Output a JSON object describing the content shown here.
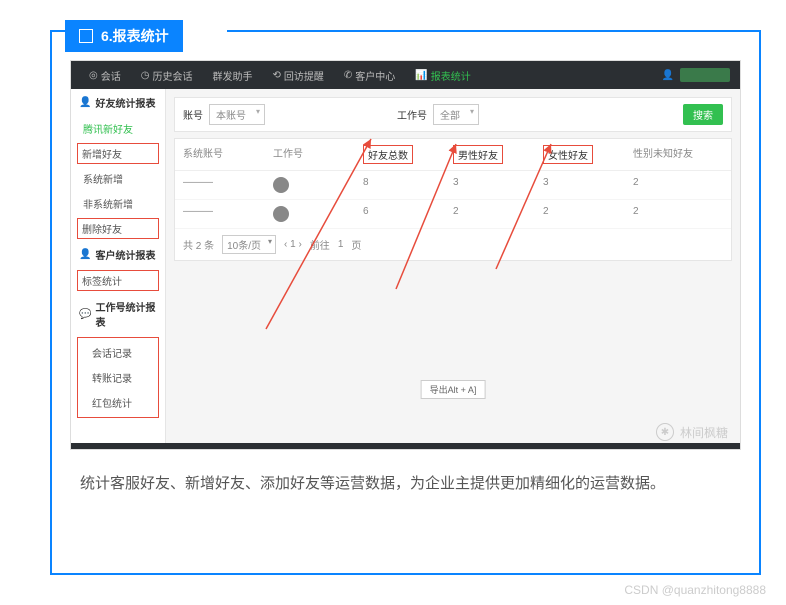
{
  "header": {
    "title": "6.报表统计"
  },
  "topnav": {
    "items": [
      {
        "label": "会话"
      },
      {
        "label": "历史会话"
      },
      {
        "label": "群发助手"
      },
      {
        "label": "回访提醒"
      },
      {
        "label": "客户中心"
      },
      {
        "label": "报表统计",
        "active": true
      }
    ],
    "user_icon": "👤"
  },
  "sidebar": {
    "group1": {
      "title": "好友统计报表",
      "items": [
        {
          "label": "腾讯新好友",
          "active": true
        },
        {
          "label": "新增好友",
          "boxed": true
        },
        {
          "label": "系统新增"
        },
        {
          "label": "非系统新增"
        },
        {
          "label": "删除好友",
          "boxed": true
        }
      ]
    },
    "group2": {
      "title": "客户统计报表",
      "items": [
        {
          "label": "标签统计",
          "boxed": true
        }
      ]
    },
    "group3": {
      "title": "工作号统计报表",
      "items": [
        {
          "label": "会话记录"
        },
        {
          "label": "转账记录"
        },
        {
          "label": "红包统计"
        }
      ]
    }
  },
  "filters": {
    "f1_label": "账号",
    "f1_value": "本账号",
    "f2_label": "工作号",
    "f2_value": "全部",
    "search": "搜索"
  },
  "table": {
    "headers": [
      "系统账号",
      "工作号",
      "好友总数",
      "男性好友",
      "女性好友",
      "性别未知好友"
    ],
    "highlight": [
      2,
      3,
      4
    ],
    "rows": [
      {
        "c0": "———",
        "c1_has_avatar": true,
        "c2": "8",
        "c3": "3",
        "c4": "3",
        "c5": "2"
      },
      {
        "c0": "———",
        "c1_has_avatar": true,
        "c2": "6",
        "c3": "2",
        "c4": "2",
        "c5": "2"
      }
    ],
    "pager": {
      "total": "共 2 条",
      "pagesize": "10条/页",
      "nav": "‹  1  ›",
      "goto": "前往",
      "page": "1",
      "unit": "页"
    }
  },
  "export_btn": "导出Alt + A]",
  "watermark": "林间枫糖",
  "caption": "统计客服好友、新增好友、添加好友等运营数据，为企业主提供更加精细化的运营数据。",
  "csdn": "CSDN @quanzhitong8888"
}
